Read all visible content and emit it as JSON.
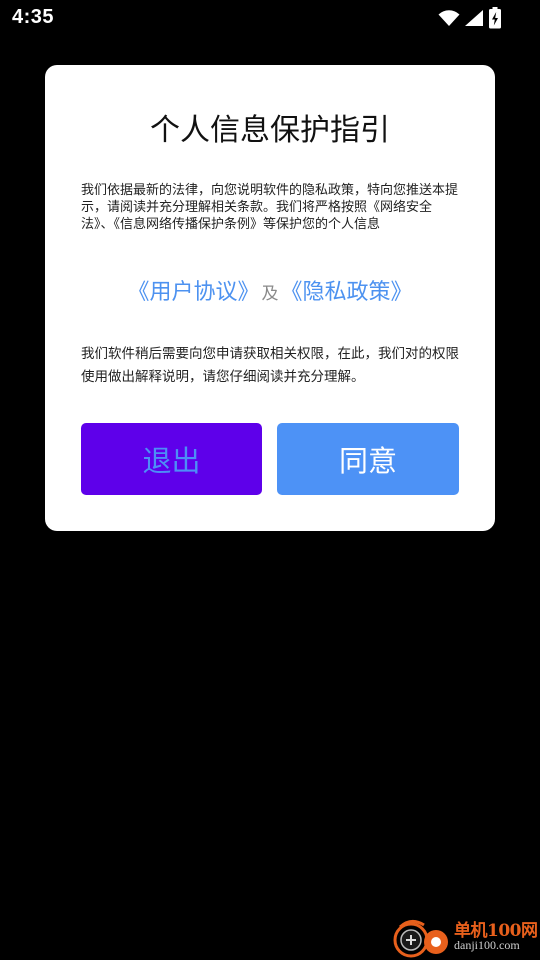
{
  "status_bar": {
    "time": "4:35",
    "icons": [
      "wifi-icon",
      "cellular-signal-icon",
      "battery-charging-icon"
    ]
  },
  "dialog": {
    "title": "个人信息保护指引",
    "intro_text": "我们依据最新的法律，向您说明软件的隐私政策，特向您推送本提示，请阅读并充分理解相关条款。我们将严格按照《网络安全法》、《信息网络传播保护条例》等保护您的个人信息",
    "user_agreement_link": "《用户协议》",
    "and_text": "及",
    "privacy_policy_link": "《隐私政策》",
    "permission_text": "我们软件稍后需要向您申请获取相关权限，在此，我们对的权限使用做出解释说明，请您仔细阅读并充分理解。",
    "exit_label": "退出",
    "agree_label": "同意"
  },
  "watermark": {
    "name": "单机100网",
    "url": "danji100.com"
  },
  "colors": {
    "background": "#000000",
    "dialog_bg": "#ffffff",
    "link": "#4d92f0",
    "exit_button_bg": "#5e00ea",
    "exit_button_text": "#4d8ef6",
    "agree_button_bg": "#4d92f6",
    "agree_button_text": "#ffffff"
  }
}
